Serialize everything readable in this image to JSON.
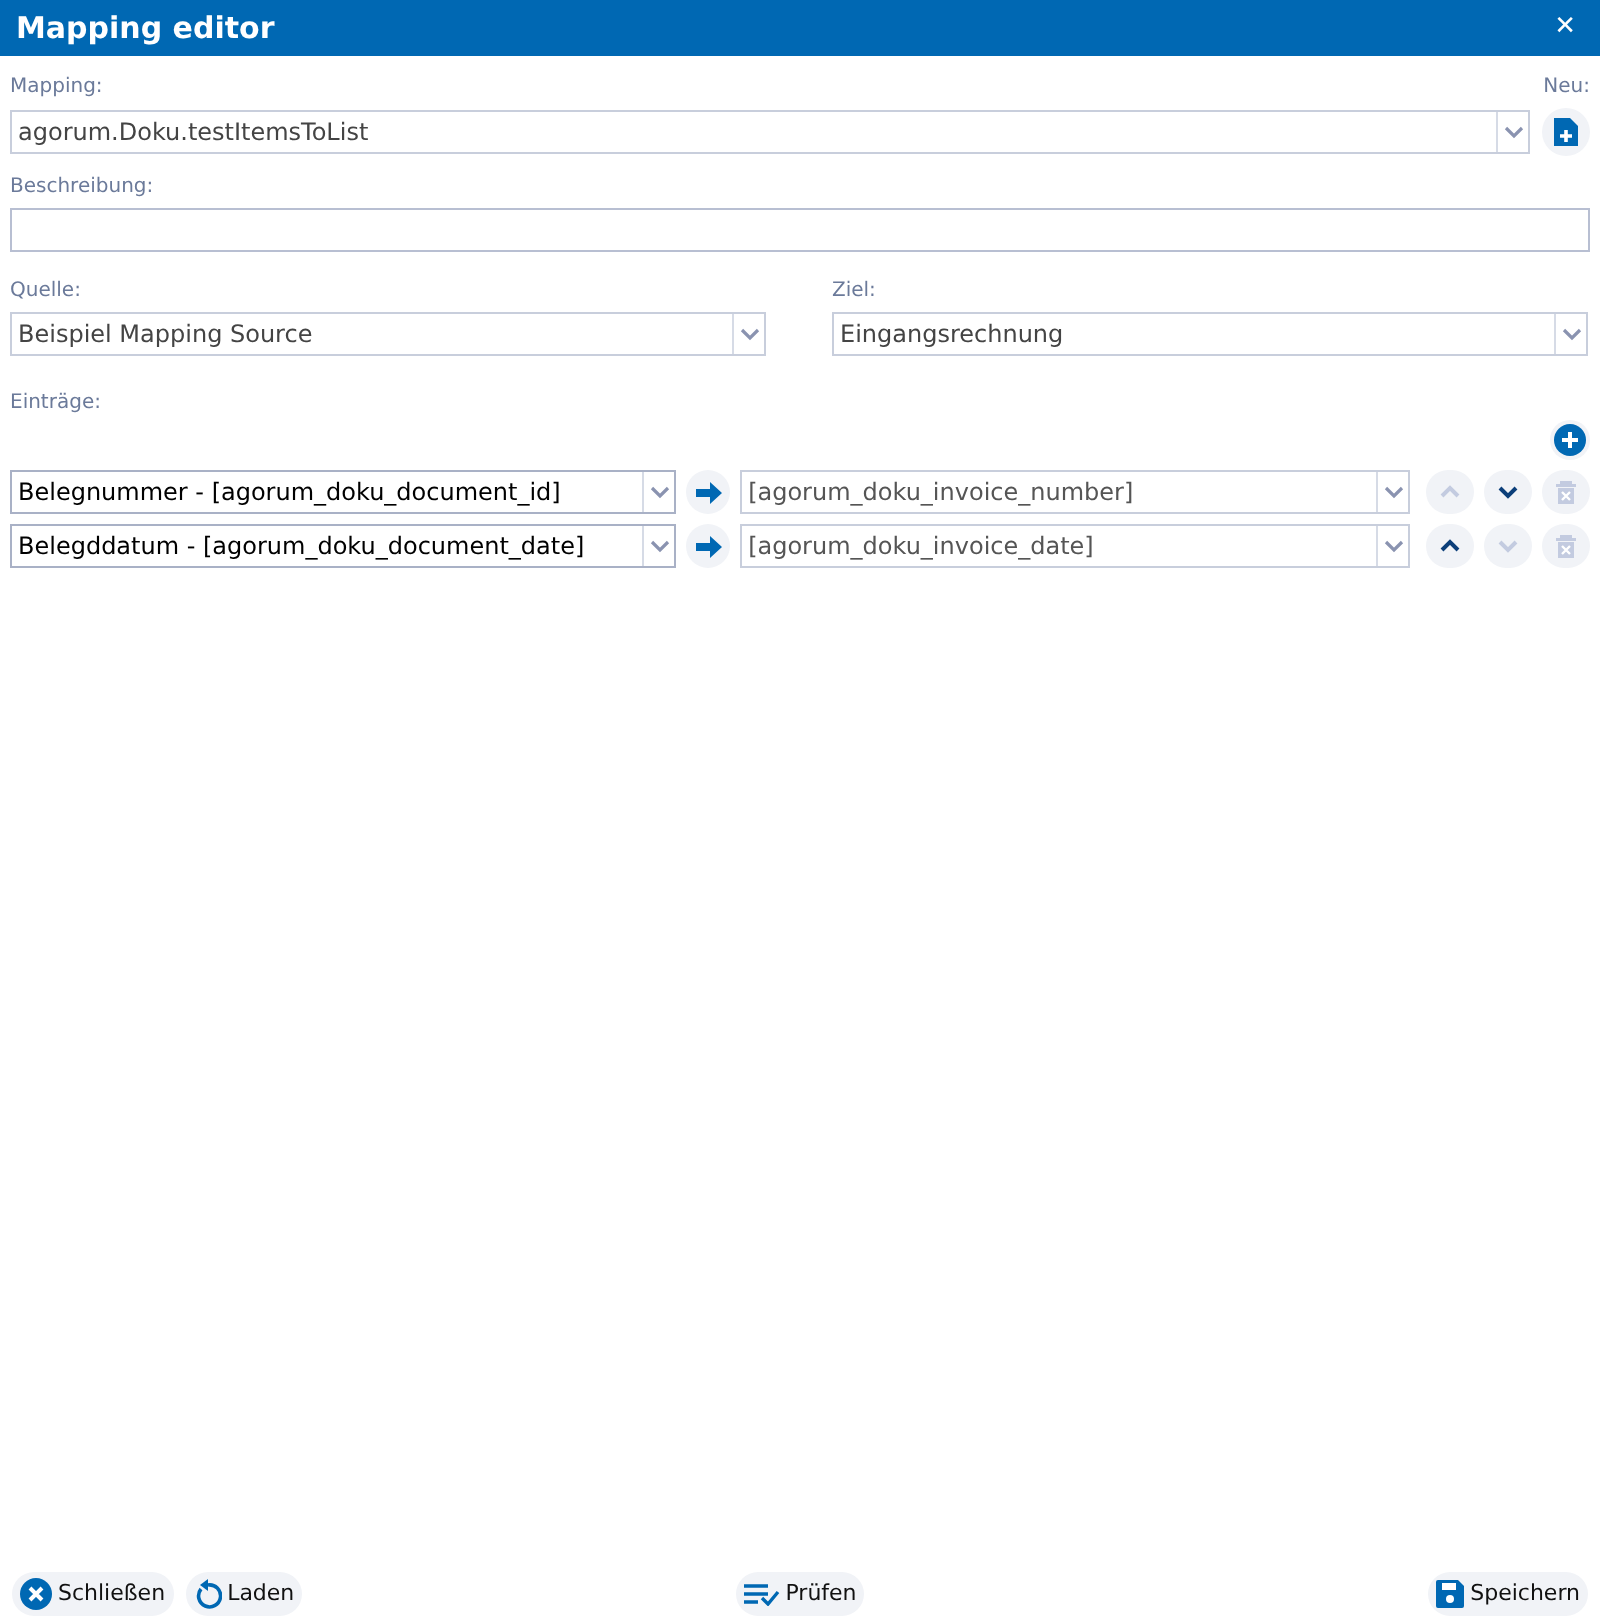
{
  "window": {
    "title": "Mapping editor",
    "close": "✕"
  },
  "mapping": {
    "label": "Mapping:",
    "value": "agorum.Doku.testItemsToList",
    "new_label": "Neu:"
  },
  "description": {
    "label": "Beschreibung:"
  },
  "source": {
    "label": "Quelle:",
    "value": "Beispiel Mapping Source"
  },
  "target": {
    "label": "Ziel:",
    "value": "Eingangsrechnung"
  },
  "entries_label": "Einträge:",
  "entries": [
    {
      "source": "Belegnummer - [agorum_doku_document_id]",
      "target": "[agorum_doku_invoice_number]",
      "up_disabled": true,
      "down_disabled": false,
      "delete_disabled": true
    },
    {
      "source": "Belegddatum - [agorum_doku_document_date]",
      "target": "[agorum_doku_invoice_date]",
      "up_disabled": false,
      "down_disabled": true,
      "delete_disabled": true
    }
  ],
  "footer": [
    {
      "kind": "close",
      "label": "Schließen"
    },
    {
      "kind": "reload",
      "label": "Laden"
    },
    {
      "kind": "check",
      "label": "Prüfen"
    },
    {
      "kind": "save",
      "label": "Speichern"
    }
  ]
}
